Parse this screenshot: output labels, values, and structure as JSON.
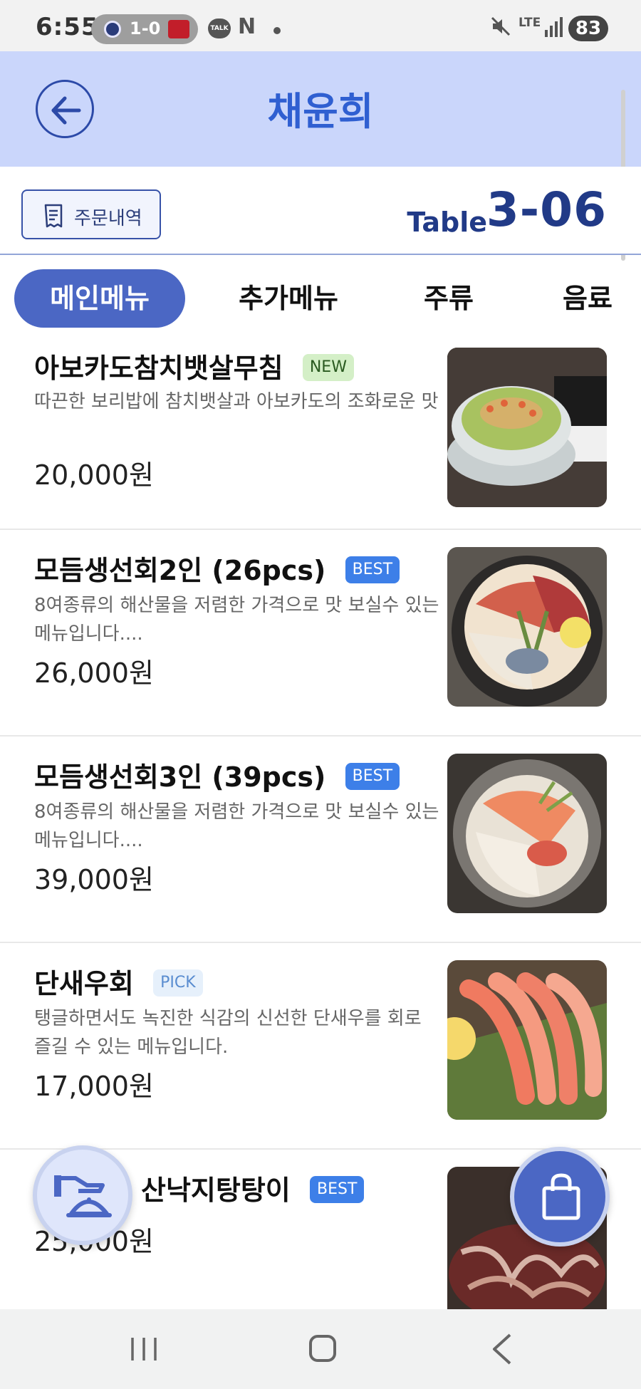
{
  "status_bar": {
    "time": "6:55",
    "score": "1-0",
    "talk_label": "TALK",
    "n_label": "N",
    "network": "LTE",
    "battery": "83"
  },
  "header": {
    "title": "채윤희",
    "back_icon": "arrow-left-icon"
  },
  "subbar": {
    "order_history_label": "주문내역",
    "table_label": "Table",
    "table_number": "3-06"
  },
  "tabs": [
    {
      "label": "메인메뉴",
      "active": true
    },
    {
      "label": "추가메뉴",
      "active": false
    },
    {
      "label": "주류",
      "active": false
    },
    {
      "label": "음료",
      "active": false
    }
  ],
  "menu_items": [
    {
      "name": "아보카도참치뱃살무침",
      "badge": "NEW",
      "badge_type": "new",
      "desc": "따끈한 보리밥에 참치뱃살과 아보카도의 조화로운 맛",
      "price": "20,000원"
    },
    {
      "name": "모듬생선회2인 (26pcs)",
      "badge": "BEST",
      "badge_type": "best",
      "desc": "8여종류의 해산물을 저렴한 가격으로 맛 보실수 있는 메뉴입니다....",
      "price": "26,000원"
    },
    {
      "name": "모듬생선회3인 (39pcs)",
      "badge": "BEST",
      "badge_type": "best",
      "desc": "8여종류의 해산물을 저렴한 가격으로 맛 보실수 있는 메뉴입니다....",
      "price": "39,000원"
    },
    {
      "name": "단새우회",
      "badge": "PICK",
      "badge_type": "pick",
      "desc": "탱글하면서도 녹진한 식감의 신선한 단새우를 회로 즐길 수 있는 메뉴입니다.",
      "price": "17,000원"
    },
    {
      "name": "산낙지탕탕이",
      "badge": "BEST",
      "badge_type": "best",
      "desc": "",
      "price": "25,000원"
    }
  ],
  "colors": {
    "accent": "#4b67c4",
    "header_bg": "#cad6fb",
    "title": "#2f5fd1",
    "table_text": "#213a87"
  }
}
